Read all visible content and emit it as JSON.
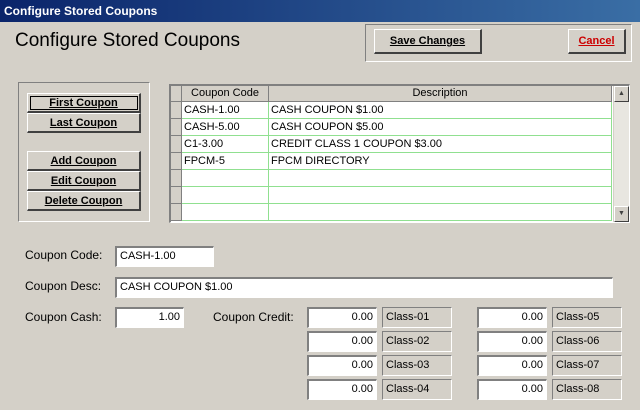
{
  "window": {
    "title": "Configure Stored Coupons"
  },
  "heading": "Configure Stored Coupons",
  "buttons": {
    "save": "Save Changes",
    "cancel": "Cancel",
    "first": "First Coupon",
    "last": "Last Coupon",
    "add": "Add Coupon",
    "edit": "Edit Coupon",
    "delete": "Delete Coupon"
  },
  "grid": {
    "columns": [
      "Coupon Code",
      "Description"
    ],
    "rows": [
      [
        "CASH-1.00",
        "CASH COUPON $1.00"
      ],
      [
        "CASH-5.00",
        "CASH COUPON $5.00"
      ],
      [
        "C1-3.00",
        "CREDIT CLASS 1 COUPON $3.00"
      ],
      [
        "FPCM-5",
        "FPCM DIRECTORY"
      ],
      [
        "",
        ""
      ],
      [
        "",
        ""
      ],
      [
        "",
        ""
      ]
    ]
  },
  "form": {
    "code_label": "Coupon Code:",
    "code_value": "CASH-1.00",
    "desc_label": "Coupon Desc:",
    "desc_value": "CASH COUPON $1.00",
    "cash_label": "Coupon Cash:",
    "cash_value": "1.00",
    "credit_label": "Coupon Credit:",
    "credits": [
      {
        "value": "0.00",
        "class": "Class-01"
      },
      {
        "value": "0.00",
        "class": "Class-02"
      },
      {
        "value": "0.00",
        "class": "Class-03"
      },
      {
        "value": "0.00",
        "class": "Class-04"
      },
      {
        "value": "0.00",
        "class": "Class-05"
      },
      {
        "value": "0.00",
        "class": "Class-06"
      },
      {
        "value": "0.00",
        "class": "Class-07"
      },
      {
        "value": "0.00",
        "class": "Class-08"
      }
    ]
  },
  "colors": {
    "cancel_text": "#cc0000",
    "grid_lines": "#90e090",
    "title_bar": "#0a246a"
  },
  "icons": {
    "scroll_up": "triangle-up-icon",
    "scroll_down": "triangle-down-icon"
  }
}
